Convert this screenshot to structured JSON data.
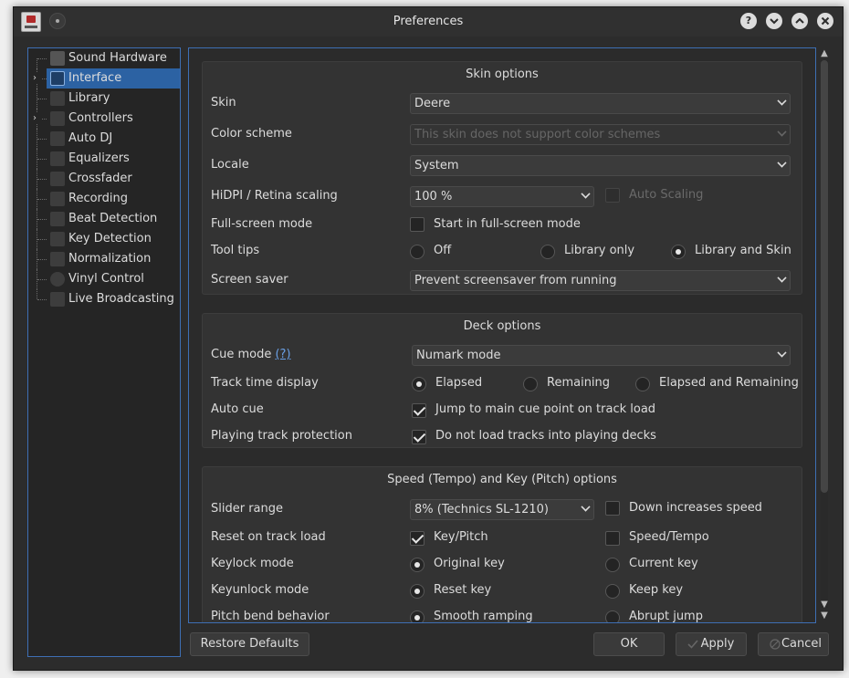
{
  "window": {
    "title": "Preferences"
  },
  "titlebar": {
    "help": "?",
    "minimize": "⌄",
    "maximize": "⌃",
    "close": "✕"
  },
  "sidebar": {
    "items": [
      {
        "label": "Sound Hardware",
        "icon": "speaker-icon"
      },
      {
        "label": "Interface",
        "icon": "interface-icon",
        "selected": true,
        "expandable": true
      },
      {
        "label": "Library",
        "icon": "library-icon"
      },
      {
        "label": "Controllers",
        "icon": "controller-icon",
        "expandable": true
      },
      {
        "label": "Auto DJ",
        "icon": "autodj-icon"
      },
      {
        "label": "Equalizers",
        "icon": "equalizer-icon"
      },
      {
        "label": "Crossfader",
        "icon": "crossfader-icon"
      },
      {
        "label": "Recording",
        "icon": "recording-icon"
      },
      {
        "label": "Beat Detection",
        "icon": "beat-detection-icon"
      },
      {
        "label": "Key Detection",
        "icon": "key-detection-icon"
      },
      {
        "label": "Normalization",
        "icon": "normalization-icon"
      },
      {
        "label": "Vinyl Control",
        "icon": "vinyl-icon"
      },
      {
        "label": "Live Broadcasting",
        "icon": "broadcast-icon"
      }
    ]
  },
  "skin_options": {
    "title": "Skin options",
    "skin": {
      "label": "Skin",
      "value": "Deere"
    },
    "color_scheme": {
      "label": "Color scheme",
      "value": "This skin does not support color schemes"
    },
    "locale": {
      "label": "Locale",
      "value": "System"
    },
    "hidpi": {
      "label": "HiDPI / Retina scaling",
      "value": "100 %",
      "auto_scaling": "Auto Scaling"
    },
    "fullscreen": {
      "label": "Full-screen mode",
      "option": "Start in full-screen mode"
    },
    "tooltips": {
      "label": "Tool tips",
      "off": "Off",
      "library_only": "Library only",
      "library_and_skin": "Library and Skin"
    },
    "screensaver": {
      "label": "Screen saver",
      "value": "Prevent screensaver from running"
    }
  },
  "deck_options": {
    "title": "Deck options",
    "cue_mode": {
      "label": "Cue mode",
      "help": "(?)",
      "value": "Numark mode"
    },
    "track_time": {
      "label": "Track time display",
      "elapsed": "Elapsed",
      "remaining": "Remaining",
      "elapsed_remaining": "Elapsed and Remaining"
    },
    "auto_cue": {
      "label": "Auto cue",
      "option": "Jump to main cue point on track load"
    },
    "playing_protection": {
      "label": "Playing track protection",
      "option": "Do not load tracks into playing decks"
    }
  },
  "speed_options": {
    "title": "Speed (Tempo) and Key (Pitch) options",
    "slider_range": {
      "label": "Slider range",
      "value": "8% (Technics SL-1210)",
      "down_increases": "Down increases speed"
    },
    "reset_on_load": {
      "label": "Reset on track load",
      "key_pitch": "Key/Pitch",
      "speed_tempo": "Speed/Tempo"
    },
    "keylock": {
      "label": "Keylock mode",
      "original": "Original key",
      "current": "Current key"
    },
    "keyunlock": {
      "label": "Keyunlock mode",
      "reset": "Reset key",
      "keep": "Keep key"
    },
    "pitch_bend": {
      "label": "Pitch bend behavior",
      "smooth": "Smooth ramping",
      "abrupt": "Abrupt jump"
    }
  },
  "buttons": {
    "restore_defaults": "Restore Defaults",
    "ok": "OK",
    "apply": "Apply",
    "cancel": "Cancel"
  },
  "colors": {
    "accent": "#3e6fb4",
    "selected": "#2c62a3",
    "background": "#2c2c2c"
  }
}
